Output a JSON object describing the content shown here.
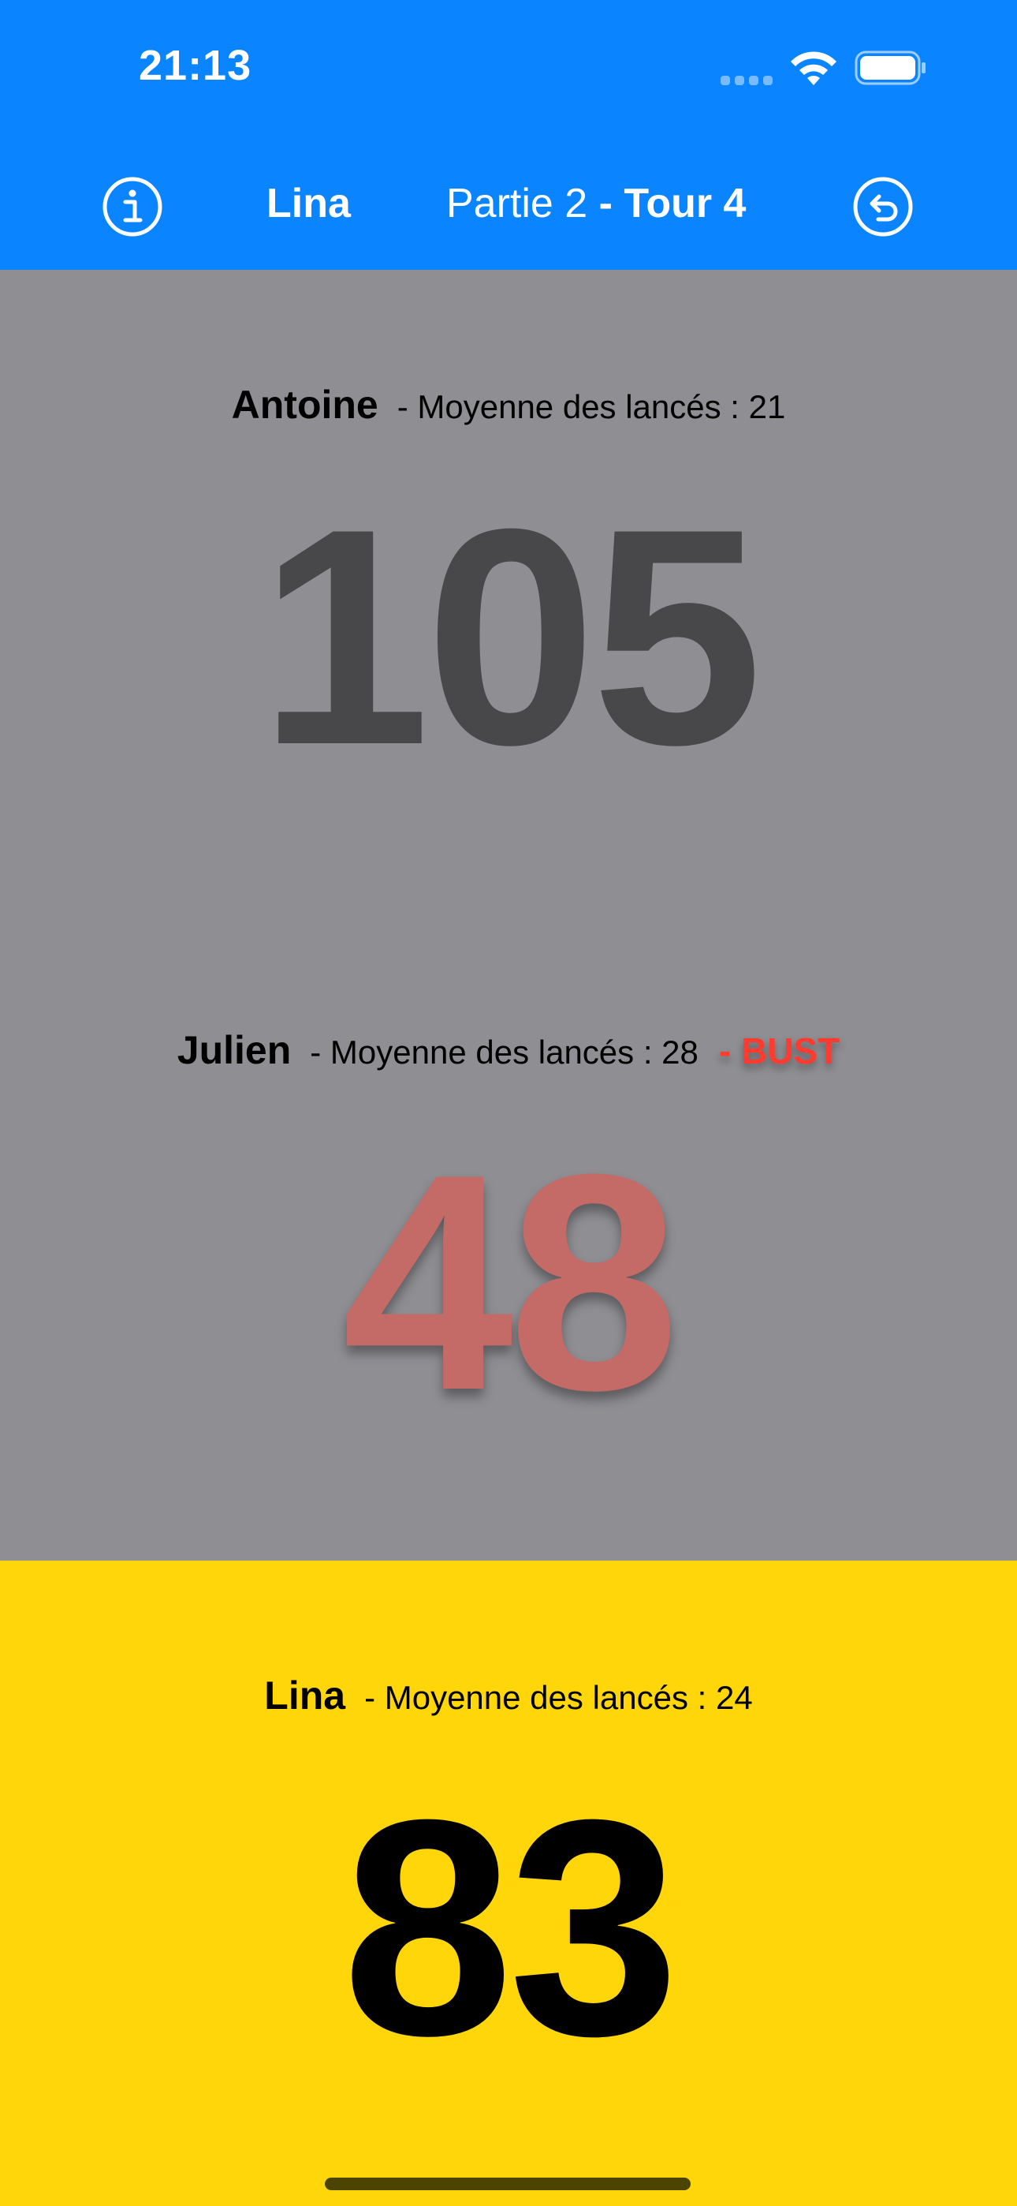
{
  "status_bar": {
    "time": "21:13",
    "wifi_icon": "wifi-icon",
    "battery_icon": "battery-icon",
    "signal_icon": "cellular-signal-icon"
  },
  "nav": {
    "info_icon": "info-circle-icon",
    "current_player": "Lina",
    "round_label": "Partie 2",
    "turn_label": "- Tour 4",
    "undo_icon": "undo-arrow-icon",
    "background_color": "#0a84ff"
  },
  "players": [
    {
      "name": "Antoine",
      "average": "- Moyenne des lancés : 21",
      "score": "105",
      "state": "inactive",
      "panel_color": "#8e8e93"
    },
    {
      "name": "Julien",
      "average": "- Moyenne des lancés : 28",
      "bust": "- BUST",
      "score": "48",
      "state": "bust",
      "panel_color": "#8e8e93"
    },
    {
      "name": "Lina",
      "average": "- Moyenne des lancés : 24",
      "score": "83",
      "state": "active",
      "panel_color": "#ffd60a"
    }
  ],
  "colors": {
    "accent": "#0a84ff",
    "active_panel": "#ffd60a",
    "bust_text": "#ff3b30"
  }
}
